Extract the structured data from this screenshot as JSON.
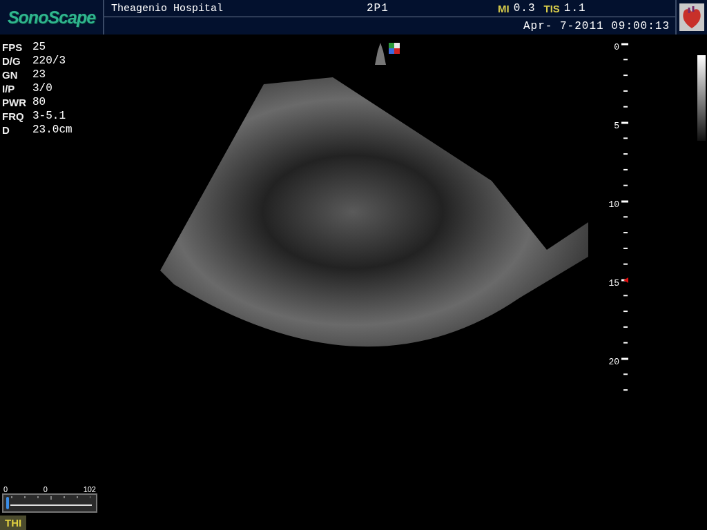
{
  "header": {
    "logo": "SonoScape",
    "hospital": "Theagenio Hospital",
    "preset": "2P1",
    "mi_label": "MI",
    "mi_value": "0.3",
    "tis_label": "TIS",
    "tis_value": "1.1",
    "datetime": "Apr- 7-2011 09:00:13"
  },
  "parameters": [
    {
      "label": "FPS",
      "value": "25"
    },
    {
      "label": "D/G",
      "value": "220/3"
    },
    {
      "label": "GN",
      "value": "23"
    },
    {
      "label": "I/P",
      "value": "3/0"
    },
    {
      "label": "PWR",
      "value": "80"
    },
    {
      "label": "FRQ",
      "value": "3-5.1"
    },
    {
      "label": "D",
      "value": "23.0cm"
    }
  ],
  "depth_scale": {
    "labels": [
      "0",
      "5",
      "10",
      "15",
      "20"
    ]
  },
  "cine": {
    "labels": [
      "0",
      "0",
      "102"
    ],
    "level": 0
  },
  "mode_badge": "THI"
}
